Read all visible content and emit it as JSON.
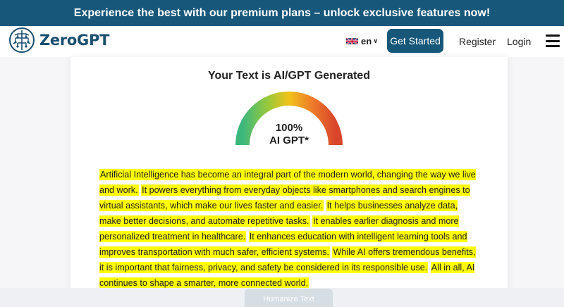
{
  "promo": {
    "text": "Experience the best with our premium plans – unlock exclusive features now!"
  },
  "nav": {
    "logo_text": "ZeroGPT",
    "lang": "en",
    "get_started": "Get Started",
    "register": "Register",
    "login": "Login"
  },
  "result": {
    "title": "Your Text is AI/GPT Generated",
    "percent": "100%",
    "label": "AI GPT*",
    "ai_score": 1.0
  },
  "text": {
    "sentences": [
      "Artificial Intelligence has become an integral part of the modern world, changing the way we live and work.",
      "It powers everything from everyday objects like smartphones and search engines to virtual assistants, which make our lives faster and easier.",
      "It helps businesses analyze data, make better decisions, and automate repetitive tasks.",
      "It enables earlier diagnosis and more personalized treatment in healthcare.",
      "It enhances education with intelligent learning tools and improves transportation with much safer, efficient systems.",
      "While AI offers tremendous benefits, it is important that fairness, privacy, and safety be considered in its responsible use.",
      "All in all, AI continues to shape a smarter, more connected world."
    ]
  },
  "actions": {
    "humanize": "Humanize Text"
  },
  "colors": {
    "brand": "#17577a",
    "highlight": "#ffff00"
  }
}
